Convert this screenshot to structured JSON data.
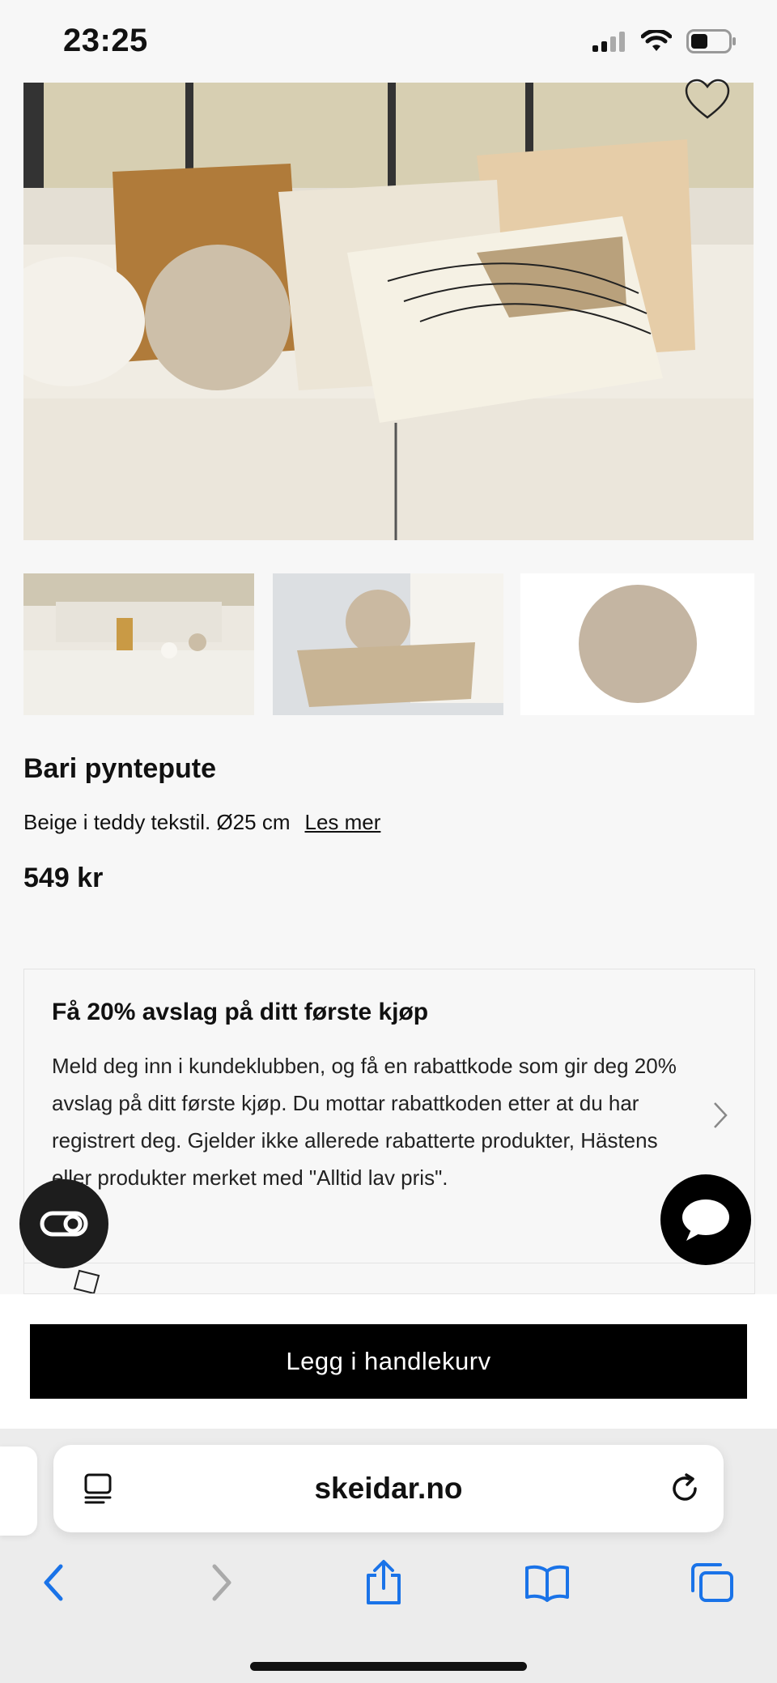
{
  "status_bar": {
    "time": "23:25"
  },
  "product": {
    "title": "Bari pyntepute",
    "description": "Beige i teddy tekstil. Ø25 cm",
    "read_more": "Les mer",
    "price": "549 kr"
  },
  "promo": {
    "title": "Få 20% avslag på ditt første kjøp",
    "body": "Meld deg inn i kundeklubben, og få en rabattkode som gir deg 20% avslag på ditt første kjøp. Du mottar rabattkoden etter at du har registrert deg. Gjelder ikke allerede rabatterte produkter, Hästens eller produkter merket med \"Alltid lav pris\"."
  },
  "cart": {
    "button_label": "Legg i handlekurv"
  },
  "browser": {
    "url": "skeidar.no"
  },
  "colors": {
    "accent": "#1a73e8",
    "button_bg": "#000000",
    "page_bg": "#f7f7f7"
  }
}
